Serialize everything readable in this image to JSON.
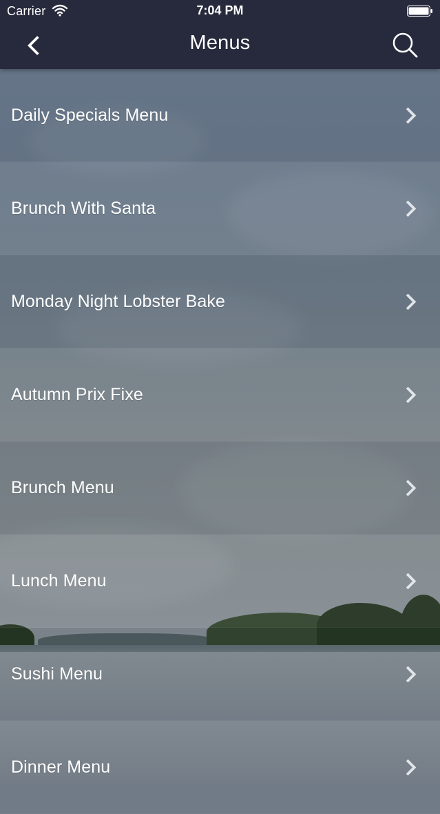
{
  "status_bar": {
    "carrier": "Carrier",
    "time": "7:04 PM"
  },
  "nav": {
    "title": "Menus",
    "back_icon": "chevron-left-icon",
    "search_icon": "search-icon"
  },
  "menus": [
    {
      "label": "Daily Specials Menu"
    },
    {
      "label": "Brunch With Santa"
    },
    {
      "label": "Monday Night Lobster Bake"
    },
    {
      "label": "Autumn Prix Fixe"
    },
    {
      "label": "Brunch Menu"
    },
    {
      "label": "Lunch Menu"
    },
    {
      "label": "Sushi Menu"
    },
    {
      "label": "Dinner Menu"
    }
  ],
  "colors": {
    "topbar": "#272a3c",
    "text": "#ffffff"
  }
}
